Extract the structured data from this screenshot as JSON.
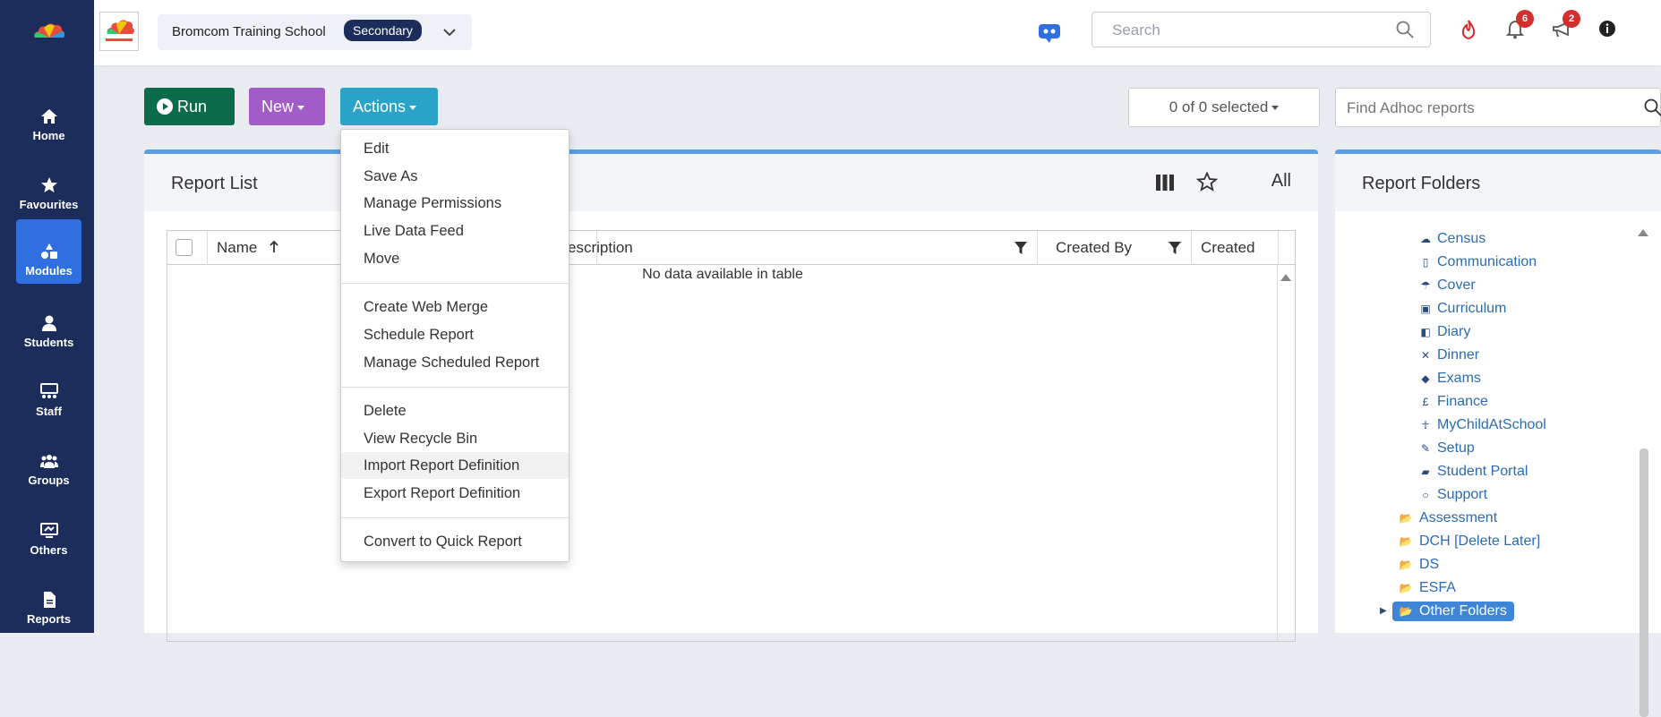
{
  "sidebar": {
    "items": [
      {
        "label": "Home",
        "icon": "home-icon"
      },
      {
        "label": "Favourites",
        "icon": "star-icon"
      },
      {
        "label": "Modules",
        "icon": "modules-icon"
      },
      {
        "label": "Students",
        "icon": "student-icon"
      },
      {
        "label": "Staff",
        "icon": "staff-icon"
      },
      {
        "label": "Groups",
        "icon": "groups-icon"
      },
      {
        "label": "Others",
        "icon": "others-icon"
      },
      {
        "label": "Reports",
        "icon": "report-icon"
      }
    ],
    "active": "Modules"
  },
  "topbar": {
    "school": "Bromcom Training School",
    "school_badge": "Secondary",
    "search_placeholder": "Search",
    "notification_count": "6",
    "announcement_count": "2"
  },
  "toolbar": {
    "run_label": "Run",
    "new_label": "New",
    "actions_label": "Actions",
    "selected_text": "0 of 0 selected",
    "find_placeholder": "Find Adhoc reports"
  },
  "report_list": {
    "title": "Report List",
    "all_label": "All",
    "columns": [
      "Name",
      "escription",
      "Created By",
      "Created"
    ],
    "empty_text": "No data available in table"
  },
  "actions_menu": {
    "groups": [
      [
        "Edit",
        "Save As",
        "Manage Permissions",
        "Live Data Feed",
        "Move"
      ],
      [
        "Create Web Merge",
        "Schedule Report",
        "Manage Scheduled Report"
      ],
      [
        "Delete",
        "View Recycle Bin",
        "Import Report Definition",
        "Export Report Definition"
      ],
      [
        "Convert to Quick Report"
      ]
    ],
    "highlighted": "Import Report Definition"
  },
  "report_folders": {
    "title": "Report Folders",
    "modules": [
      {
        "label": "Census",
        "icon": "cloud-icon"
      },
      {
        "label": "Communication",
        "icon": "phone-icon"
      },
      {
        "label": "Cover",
        "icon": "cover-icon"
      },
      {
        "label": "Curriculum",
        "icon": "calendar-icon"
      },
      {
        "label": "Diary",
        "icon": "diary-icon"
      },
      {
        "label": "Dinner",
        "icon": "cutlery-icon"
      },
      {
        "label": "Exams",
        "icon": "graduation-icon"
      },
      {
        "label": "Finance",
        "icon": "pound-icon"
      },
      {
        "label": "MyChildAtSchool",
        "icon": "child-icon"
      },
      {
        "label": "Setup",
        "icon": "wrench-icon"
      },
      {
        "label": "Student Portal",
        "icon": "chat-icon"
      },
      {
        "label": "Support",
        "icon": "circle-icon"
      }
    ],
    "folders": [
      "Assessment",
      "DCH [Delete Later]",
      "DS",
      "ESFA",
      "Other Folders"
    ],
    "selected_folder": "Other Folders"
  },
  "colors": {
    "sidebar": "#1c2c5b",
    "run": "#0b6b4a",
    "new": "#a25cc7",
    "actions": "#2aa3c9",
    "accent": "#5a9fe3"
  }
}
